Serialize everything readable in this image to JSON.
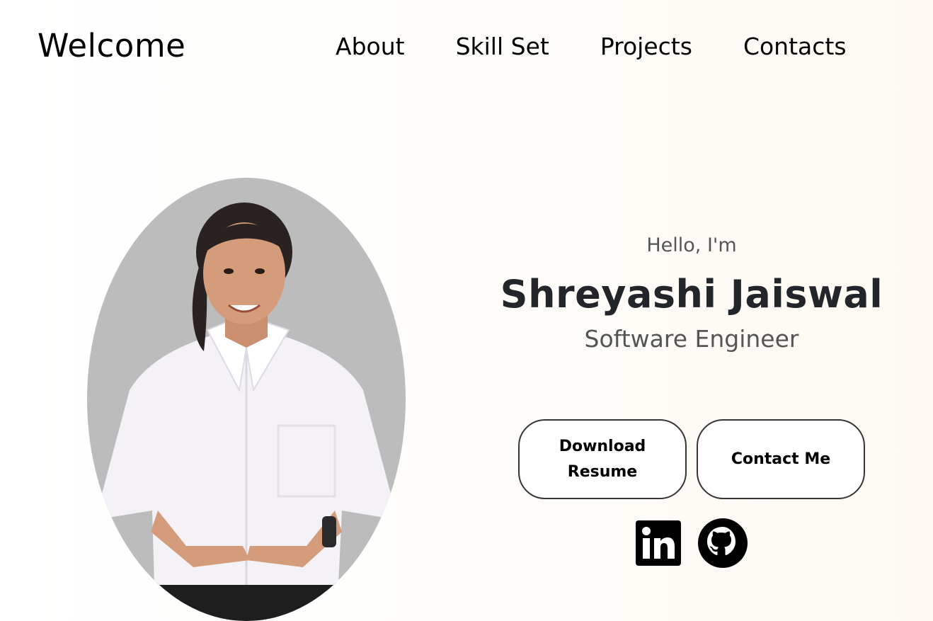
{
  "header": {
    "logo": "Welcome",
    "nav": [
      {
        "label": "About"
      },
      {
        "label": "Skill Set"
      },
      {
        "label": "Projects"
      },
      {
        "label": "Contacts"
      }
    ]
  },
  "profile": {
    "photo_icon": "profile-photo",
    "photo_background": "#bcbcbc"
  },
  "hero": {
    "greeting": "Hello, I'm",
    "name": "Shreyashi Jaiswal",
    "title": "Software Engineer"
  },
  "buttons": {
    "resume_label": "Download Resume",
    "contact_label": "Contact Me"
  },
  "socials": [
    {
      "icon": "linkedin-icon"
    },
    {
      "icon": "github-icon"
    }
  ],
  "colors": {
    "text_primary": "#000000",
    "name_color": "#222529",
    "muted_text": "#555555",
    "button_border": "#353535"
  }
}
